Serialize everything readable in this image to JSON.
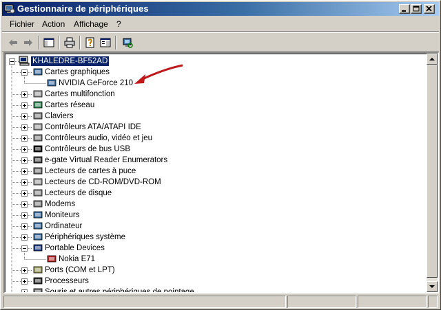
{
  "window": {
    "title": "Gestionnaire de périphériques",
    "controls": [
      "minimize",
      "maximize",
      "close"
    ]
  },
  "menu": [
    {
      "label": "Fichier"
    },
    {
      "label": "Action"
    },
    {
      "label": "Affichage"
    },
    {
      "label": "?"
    }
  ],
  "toolbar": {
    "buttons": [
      "back-arrow-icon",
      "forward-arrow-icon",
      "console-tree-icon",
      "print-icon",
      "properties-icon",
      "help-icon",
      "scan-hardware-icon"
    ]
  },
  "tree": {
    "root": "KHALEDRE-BF52AD",
    "items": [
      {
        "label": "Cartes graphiques",
        "expanded": true,
        "children": [
          {
            "label": "NVIDIA GeForce 210"
          }
        ]
      },
      {
        "label": "Cartes multifonction",
        "expanded": false
      },
      {
        "label": "Cartes réseau",
        "expanded": false
      },
      {
        "label": "Claviers",
        "expanded": false
      },
      {
        "label": "Contrôleurs ATA/ATAPI IDE",
        "expanded": false
      },
      {
        "label": "Contrôleurs audio, vidéo et jeu",
        "expanded": false
      },
      {
        "label": "Contrôleurs de bus USB",
        "expanded": false
      },
      {
        "label": "e-gate Virtual Reader Enumerators",
        "expanded": false
      },
      {
        "label": "Lecteurs de cartes à puce",
        "expanded": false
      },
      {
        "label": "Lecteurs de CD-ROM/DVD-ROM",
        "expanded": false
      },
      {
        "label": "Lecteurs de disque",
        "expanded": false
      },
      {
        "label": "Modems",
        "expanded": false
      },
      {
        "label": "Moniteurs",
        "expanded": false
      },
      {
        "label": "Ordinateur",
        "expanded": false
      },
      {
        "label": "Périphériques système",
        "expanded": false
      },
      {
        "label": "Portable Devices",
        "expanded": true,
        "children": [
          {
            "label": "Nokia E71"
          }
        ]
      },
      {
        "label": "Ports (COM et LPT)",
        "expanded": false
      },
      {
        "label": "Processeurs",
        "expanded": false
      },
      {
        "label": "Souris et autres périphériques de pointage",
        "expanded": false
      }
    ]
  },
  "annotation": {
    "color": "#c0191c"
  },
  "colors": {
    "titlebar_start": "#0a246a",
    "titlebar_end": "#a6caf0",
    "face": "#d4d0c8",
    "selection": "#0a246a"
  }
}
